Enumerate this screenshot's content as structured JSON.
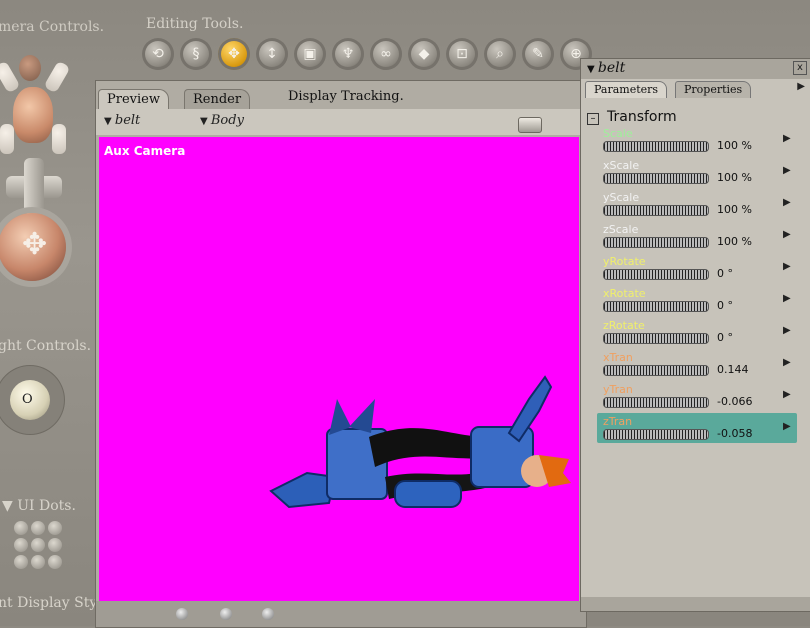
{
  "left_panel": {
    "camera_title": "mera Controls.",
    "light_title": "ght Controls.",
    "dots_title": "UI Dots.",
    "display_title": "nt Display Styl"
  },
  "toolbar": {
    "title": "Editing Tools.",
    "tools": [
      {
        "name": "rotate-tool-icon",
        "glyph": "⟲"
      },
      {
        "name": "twist-tool-icon",
        "glyph": "§"
      },
      {
        "name": "translate-tool-icon",
        "glyph": "✥",
        "active": true
      },
      {
        "name": "translate-in-out-tool-icon",
        "glyph": "↕"
      },
      {
        "name": "scale-tool-icon",
        "glyph": "▣"
      },
      {
        "name": "taper-tool-icon",
        "glyph": "♆"
      },
      {
        "name": "chain-break-tool-icon",
        "glyph": "∞"
      },
      {
        "name": "color-tool-icon",
        "glyph": "◆"
      },
      {
        "name": "grouping-tool-icon",
        "glyph": "⊡"
      },
      {
        "name": "view-magnifier-tool-icon",
        "glyph": "⌕"
      },
      {
        "name": "morph-brush-tool-icon",
        "glyph": "✎"
      },
      {
        "name": "direct-manipulation-tool-icon",
        "glyph": "⊕"
      }
    ]
  },
  "document": {
    "tabs": [
      "Preview",
      "Render"
    ],
    "display_tracking": "Display Tracking.",
    "actor_select": "belt",
    "figure_select": "Body",
    "camera_label": "Aux Camera",
    "background_color": "#ff00ff"
  },
  "palette": {
    "title": "belt",
    "close": "x",
    "tabs": [
      "Parameters",
      "Properties"
    ],
    "group": "Transform",
    "params": [
      {
        "name": "Scale",
        "value": "100 %",
        "color": "#9ef09a"
      },
      {
        "name": "xScale",
        "value": "100 %",
        "color": "#f2f2f2"
      },
      {
        "name": "yScale",
        "value": "100 %",
        "color": "#f2f2f2"
      },
      {
        "name": "zScale",
        "value": "100 %",
        "color": "#f2f2f2"
      },
      {
        "name": "yRotate",
        "value": "0 °",
        "color": "#f0f06a"
      },
      {
        "name": "xRotate",
        "value": "0 °",
        "color": "#f0f06a"
      },
      {
        "name": "zRotate",
        "value": "0 °",
        "color": "#f0f06a"
      },
      {
        "name": "xTran",
        "value": "0.144",
        "color": "#f0a060"
      },
      {
        "name": "yTran",
        "value": "-0.066",
        "color": "#f0a060"
      },
      {
        "name": "zTran",
        "value": "-0.058",
        "color": "#f0a060",
        "selected": true
      }
    ]
  }
}
